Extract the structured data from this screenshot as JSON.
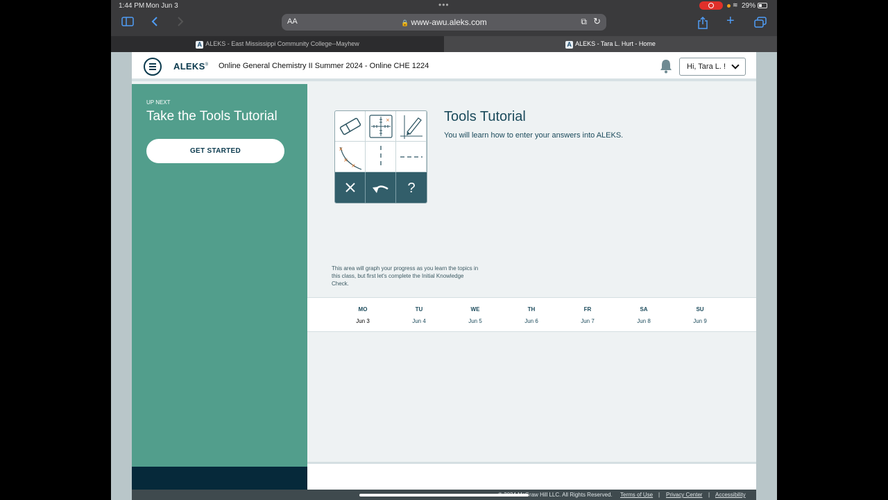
{
  "status_bar": {
    "time": "1:44 PM",
    "date": "Mon Jun 3",
    "battery": "29%"
  },
  "browser": {
    "aa": "AA",
    "url": "www-awu.aleks.com",
    "tabs": [
      {
        "title": "ALEKS - East Mississippi Community College--Mayhew"
      },
      {
        "title": "ALEKS - Tara L. Hurt - Home"
      }
    ]
  },
  "header": {
    "logo": "ALEKS",
    "logo_mark": "®",
    "course": "Online General Chemistry II Summer 2024 - Online CHE 1224",
    "user_menu": "Hi, Tara L. !"
  },
  "sidebar": {
    "up_next": "UP NEXT",
    "title": "Take the Tools Tutorial",
    "button": "GET STARTED"
  },
  "tutorial": {
    "title": "Tools Tutorial",
    "description": "You will learn how to enter your answers into ALEKS.",
    "graph_note": "This area will graph your progress as you learn the topics in this class, but first let's complete the Initial Knowledge Check."
  },
  "week": {
    "days": [
      {
        "name": "MO",
        "date": "Jun 3"
      },
      {
        "name": "TU",
        "date": "Jun 4"
      },
      {
        "name": "WE",
        "date": "Jun 5"
      },
      {
        "name": "TH",
        "date": "Jun 6"
      },
      {
        "name": "FR",
        "date": "Jun 7"
      },
      {
        "name": "SA",
        "date": "Jun 8"
      },
      {
        "name": "SU",
        "date": "Jun 9"
      }
    ]
  },
  "footer": {
    "copyright": "© 2024 McGraw Hill LLC. All Rights Reserved.",
    "links": [
      "Terms of Use",
      "Privacy Center",
      "Accessibility"
    ],
    "separator": "|"
  }
}
